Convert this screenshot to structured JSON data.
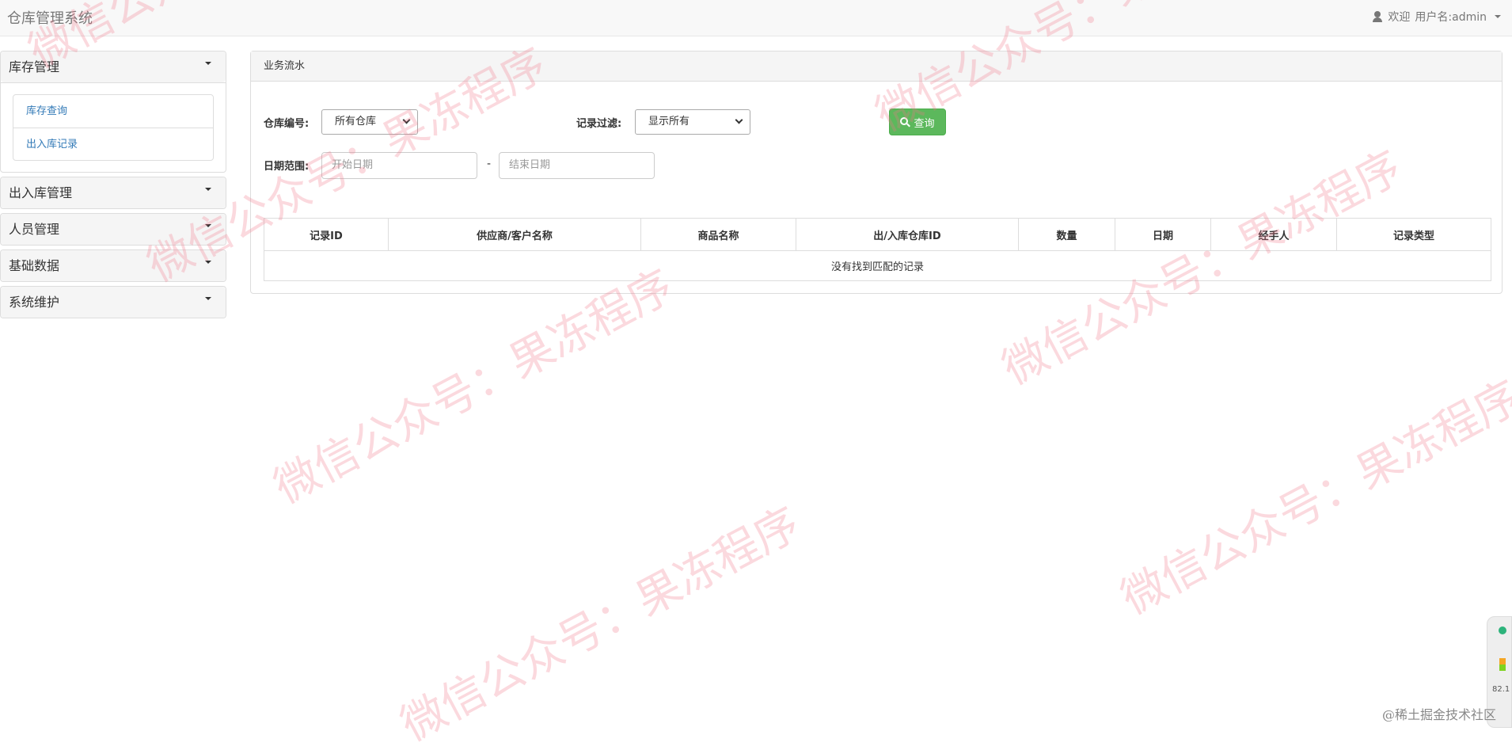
{
  "navbar": {
    "brand": "仓库管理系统",
    "welcome": "欢迎",
    "username": "用户名:admin"
  },
  "sidebar": {
    "groups": [
      {
        "title": "库存管理",
        "items": [
          "库存查询",
          "出入库记录"
        ]
      },
      {
        "title": "出入库管理"
      },
      {
        "title": "人员管理"
      },
      {
        "title": "基础数据"
      },
      {
        "title": "系统维护"
      }
    ]
  },
  "main": {
    "panel_title": "业务流水",
    "filters": {
      "warehouse_label": "仓库编号:",
      "warehouse_value": "所有仓库",
      "record_filter_label": "记录过滤:",
      "record_filter_value": "显示所有",
      "query_button": "查询",
      "date_range_label": "日期范围:",
      "start_date_placeholder": "开始日期",
      "end_date_placeholder": "结束日期",
      "separator": "-"
    },
    "table": {
      "columns": [
        "记录ID",
        "供应商/客户名称",
        "商品名称",
        "出/入库仓库ID",
        "数量",
        "日期",
        "经手人",
        "记录类型"
      ],
      "empty_text": "没有找到匹配的记录"
    }
  },
  "watermark": {
    "text": "微信公众号：果冻程序"
  },
  "overlay": {
    "widget_value": "82.1",
    "footer_text": "@稀土掘金技术社区"
  },
  "colors": {
    "accent_link": "#337ab7",
    "query_button": "#5cb85c",
    "watermark": "#f07887"
  }
}
